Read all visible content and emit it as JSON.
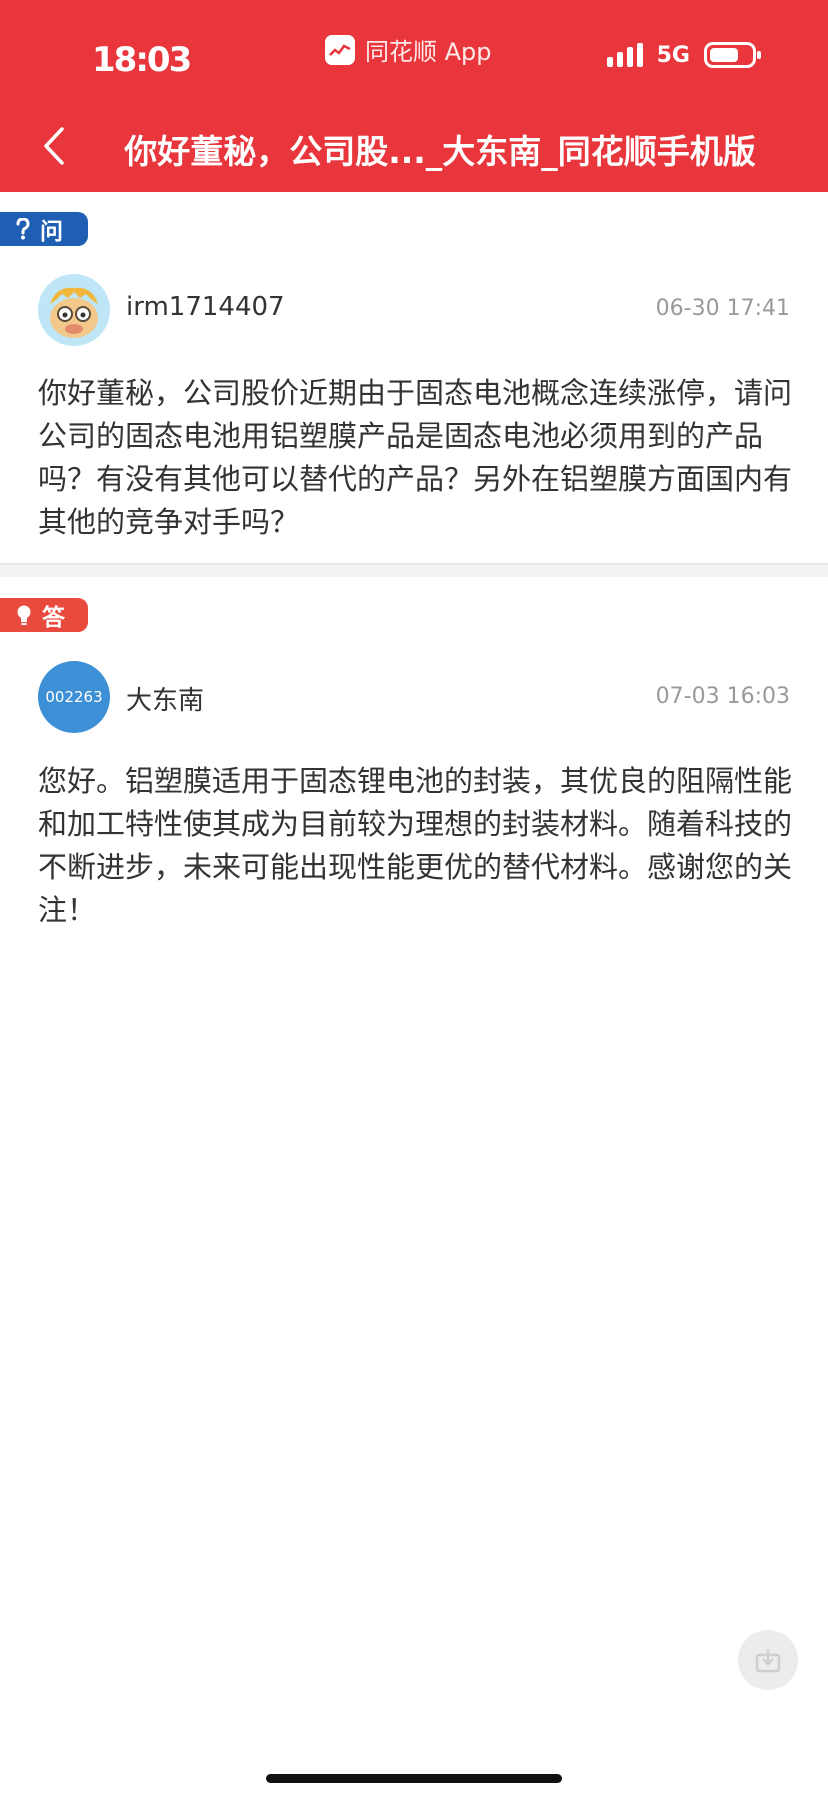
{
  "status_bar": {
    "time": "18:03",
    "app_label": "同花顺 App",
    "network": "5G"
  },
  "nav": {
    "title": "你好董秘，公司股..._大东南_同花顺手机版"
  },
  "question": {
    "badge": "问",
    "username": "irm1714407",
    "timestamp": "06-30 17:41",
    "text": "你好董秘，公司股价近期由于固态电池概念连续涨停，请问公司的固态电池用铝塑膜产品是固态电池必须用到的产品吗？有没有其他可以替代的产品？另外在铝塑膜方面国内有其他的竞争对手吗？"
  },
  "answer": {
    "badge": "答",
    "avatar_code": "002263",
    "username": "大东南",
    "timestamp": "07-03 16:03",
    "text": "您好。铝塑膜适用于固态锂电池的封装，其优良的阻隔性能和加工特性使其成为目前较为理想的封装材料。随着科技的不断进步，未来可能出现性能更优的替代材料。感谢您的关注！"
  },
  "colors": {
    "header": "#e8363c",
    "question_badge": "#1e5fb4",
    "answer_badge": "#e94a3e"
  },
  "icons": {
    "back": "chevron-left-icon",
    "question": "question-mark-icon",
    "answer": "lightbulb-icon",
    "float": "download-icon"
  }
}
